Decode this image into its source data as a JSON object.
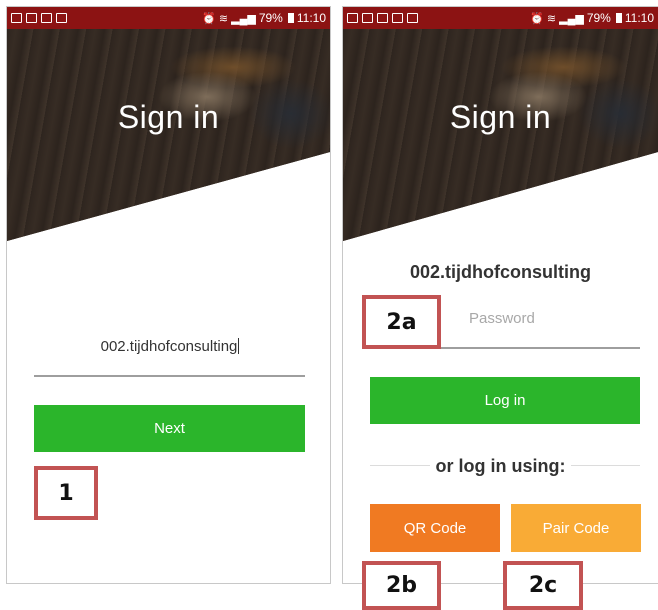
{
  "status_bar": {
    "battery": "79%",
    "time": "11:10"
  },
  "left_screen": {
    "hero_title": "Sign in",
    "domain_input_value": "002.tijdhofconsulting",
    "next_label": "Next",
    "step_label": "1"
  },
  "right_screen": {
    "hero_title": "Sign in",
    "organization": "002.tijdhofconsulting",
    "password_placeholder": "Password",
    "login_label": "Log in",
    "alt_login_label": "or log in using:",
    "qr_code_label": "QR Code",
    "pair_code_label": "Pair Code",
    "step_labels": {
      "password": "2a",
      "qr_code": "2b",
      "pair_code": "2c"
    }
  },
  "colors": {
    "status_bar": "#8c1313",
    "primary_green": "#2bb52b",
    "qr_orange": "#f07a22",
    "pair_orange": "#f9ab36",
    "annotation_border": "#c25353"
  }
}
